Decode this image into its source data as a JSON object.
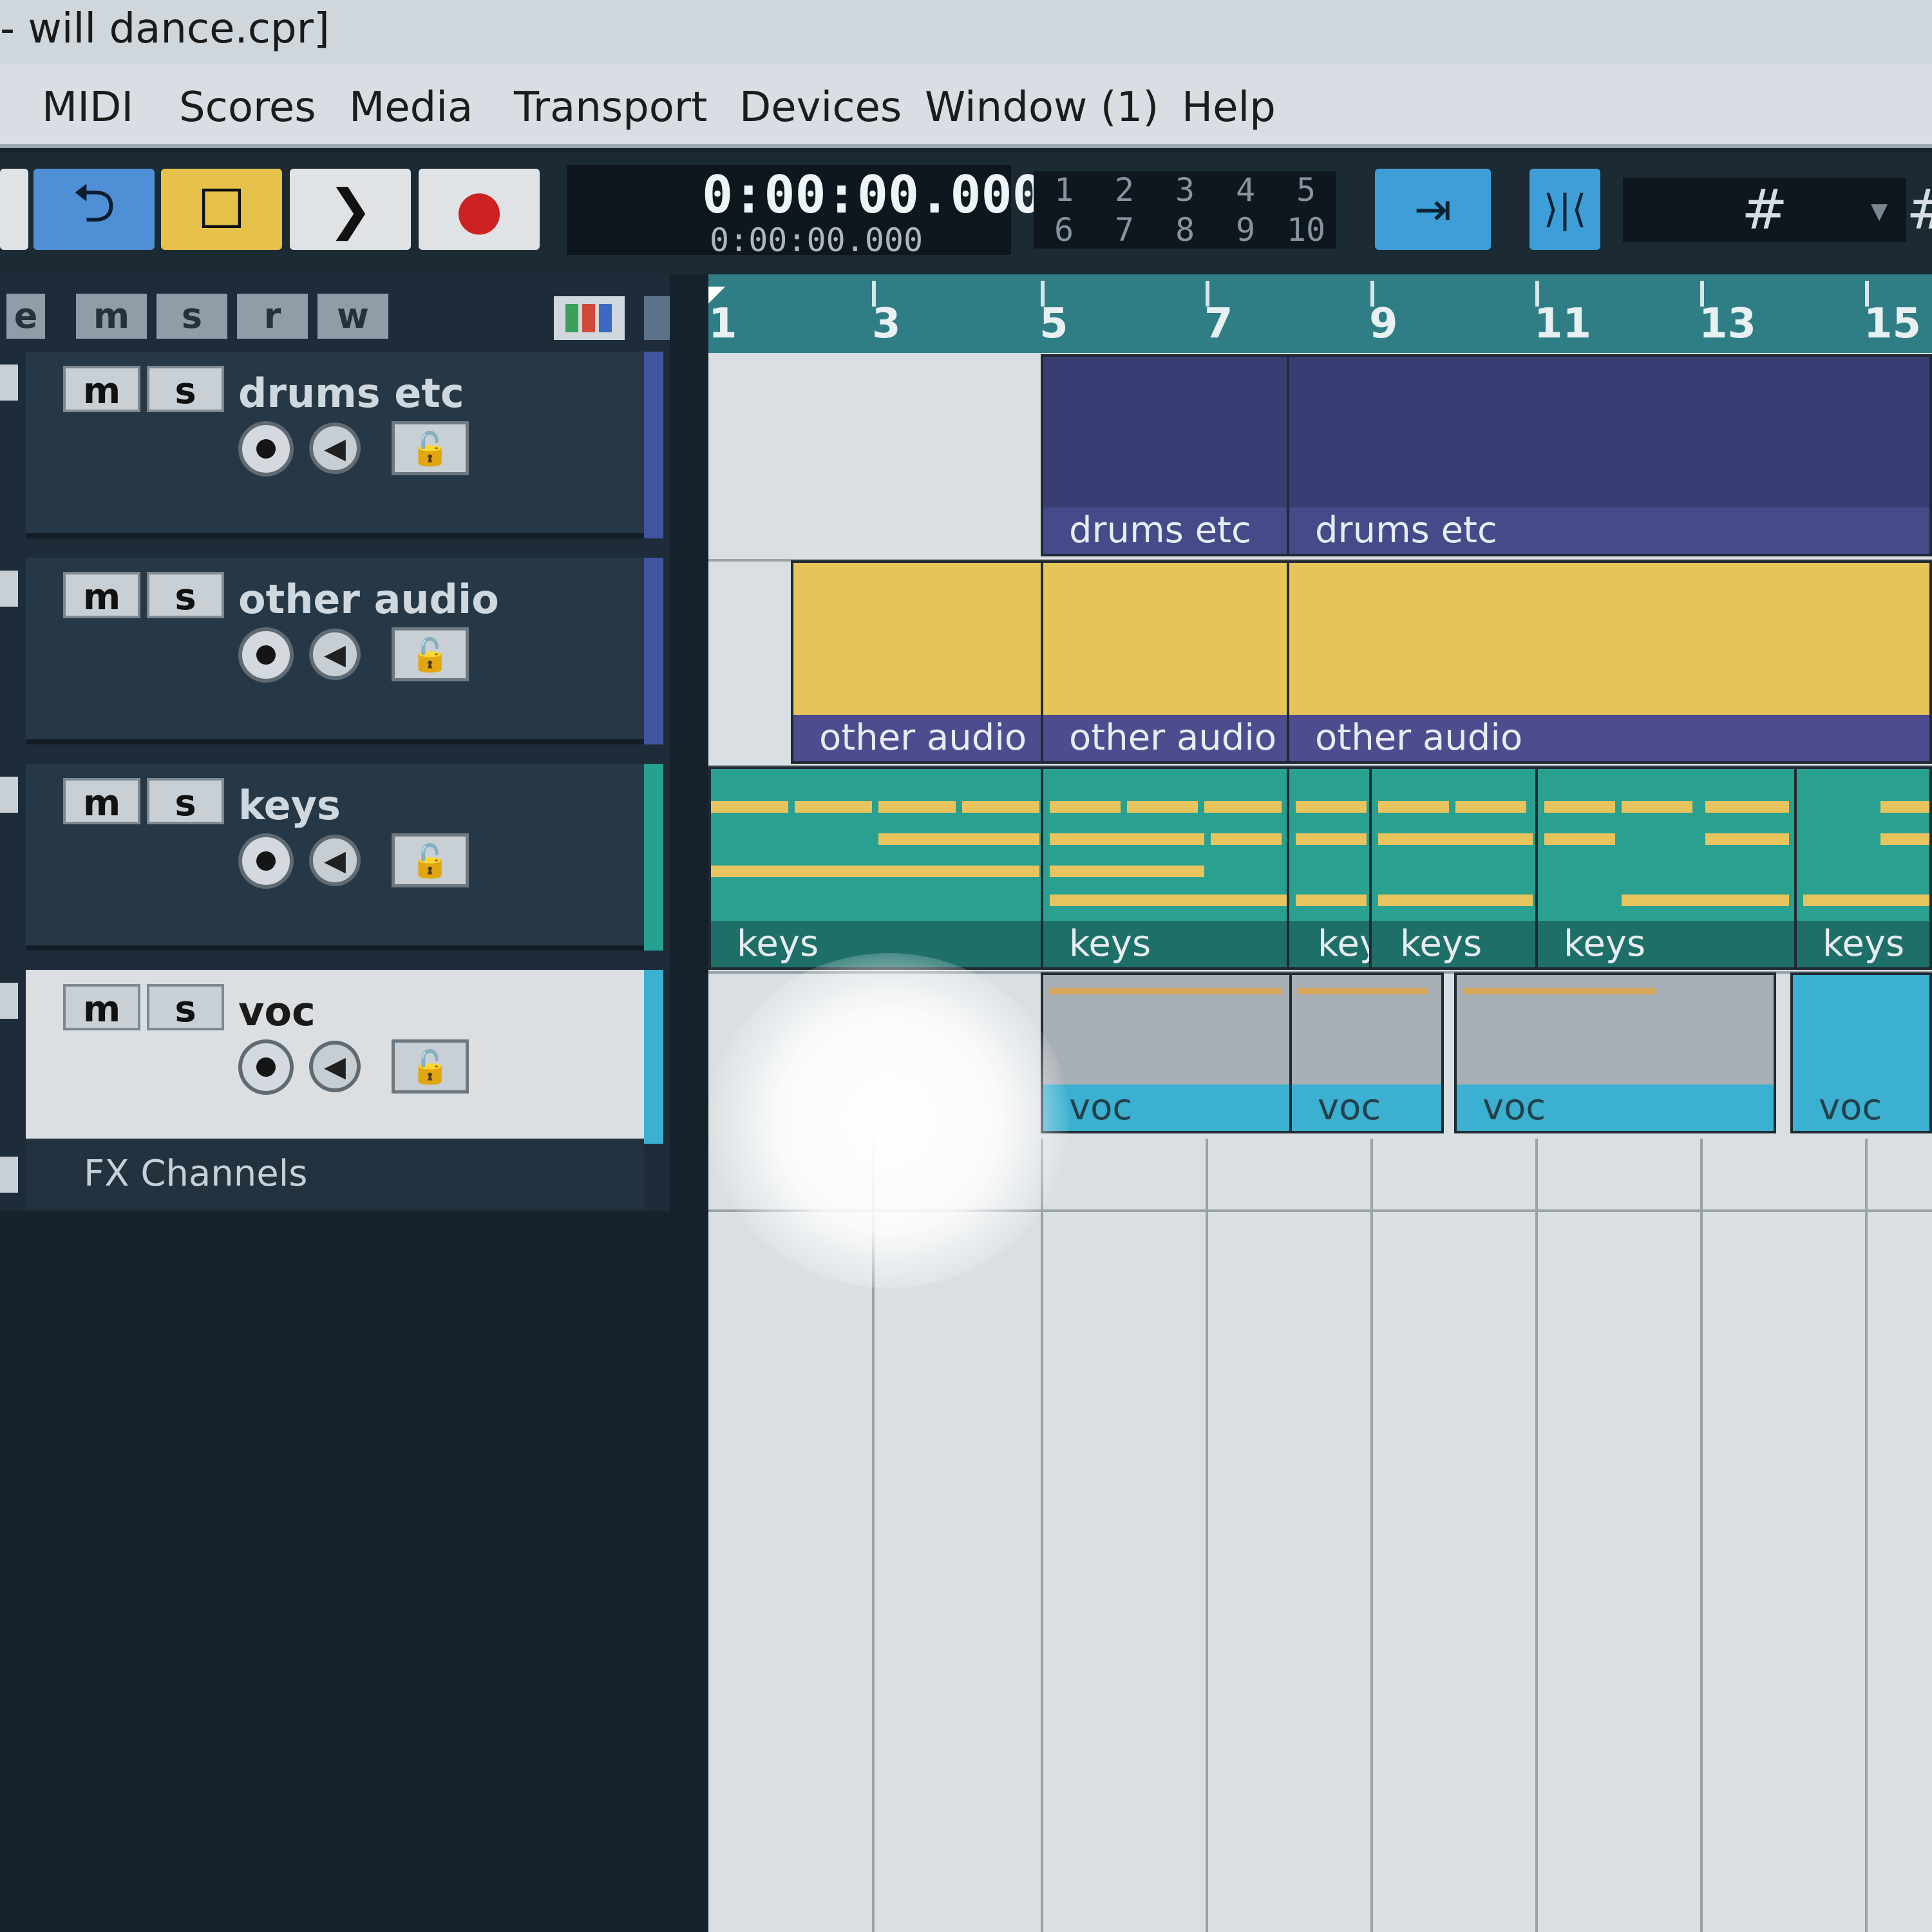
{
  "window": {
    "title": "- will dance.cpr]"
  },
  "menu": [
    "MIDI",
    "Scores",
    "Media",
    "Transport",
    "Devices",
    "Window (1)",
    "Help"
  ],
  "transport": {
    "time_primary": "0:00:00.000",
    "time_secondary": "0:00:00.000",
    "markers": [
      "1",
      "2",
      "3",
      "4",
      "5",
      "6",
      "7",
      "8",
      "9",
      "10"
    ]
  },
  "icons": {
    "cycle": "⮌",
    "stop": "☐",
    "play": "❯",
    "record": "●",
    "snap": "⇥",
    "split": "⟩|⟨",
    "grid": "#",
    "monitor": "◀",
    "lock": "🔓"
  },
  "filters": [
    "e",
    "m",
    "s",
    "r",
    "w"
  ],
  "tracks": [
    {
      "name": "drums etc",
      "mute": "m",
      "solo": "s",
      "color": "#3f55a0"
    },
    {
      "name": "other audio",
      "mute": "m",
      "solo": "s",
      "color": "#3f55a0"
    },
    {
      "name": "keys",
      "mute": "m",
      "solo": "s",
      "color": "#26a090"
    },
    {
      "name": "voc",
      "mute": "m",
      "solo": "s",
      "color": "#3bb0d0"
    }
  ],
  "fx_channels": "FX Channels",
  "ruler": [
    "1",
    "3",
    "5",
    "7",
    "9",
    "11",
    "13",
    "15"
  ],
  "events": {
    "drums": [
      "drums etc",
      "drums etc"
    ],
    "audio": [
      "other audio",
      "other audio",
      "other audio"
    ],
    "keys": [
      "keys",
      "keys",
      "key",
      "keys",
      "keys",
      "keys"
    ],
    "voc": [
      "voc",
      "voc",
      "voc",
      "voc"
    ]
  },
  "colors": {
    "accent_blue": "#3e9fd8",
    "stop_yellow": "#e7c24a",
    "audio_yellow": "#e5c45a",
    "drums_purple": "#3a3d74",
    "keys_teal": "#2aa090",
    "record_red": "#cc2222"
  }
}
